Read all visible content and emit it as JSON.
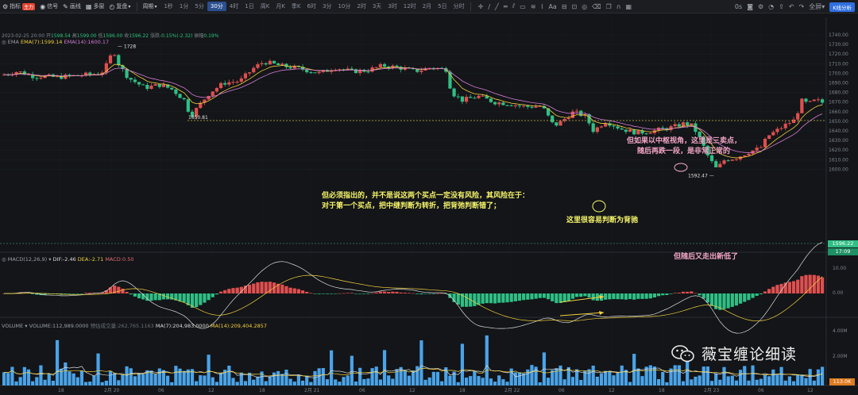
{
  "toolbar": {
    "indicators_label": "指标",
    "indicators_badge": "主力",
    "signal_label": "信号",
    "draw_label": "画线",
    "multi_label": "多窗",
    "replay_label": "复盘",
    "period_label": "周期",
    "intervals": [
      "1秒",
      "1分",
      "5分",
      "30分",
      "4时",
      "1日",
      "周K",
      "月K",
      "季K",
      "6时",
      "3分",
      "10分",
      "2时",
      "3天",
      "3时",
      "12时",
      "2月",
      "5日",
      "分时"
    ],
    "active_interval": "30分",
    "text_tool": "Aa",
    "time_readout": "0s",
    "fullscreen_label": "全屏",
    "kline_button": "K线分析"
  },
  "header": {
    "ohlc_date": "2023-02-25 20:00",
    "ohlc_open_label": "开",
    "ohlc_open": "1598.54",
    "ohlc_high_label": "高",
    "ohlc_high": "1599.00",
    "ohlc_low_label": "低",
    "ohlc_low": "1596.00",
    "ohlc_close_label": "收",
    "ohlc_close": "1596.22",
    "ohlc_change_label": "涨跌",
    "ohlc_change": "-0.15%(-2.32)",
    "ohlc_amp_label": "振幅",
    "ohlc_amp": "0.19%",
    "ema_name": "EMA",
    "ema7": "EMA(7):1599.14",
    "ema14": "EMA(14):1600.17"
  },
  "macd": {
    "name": "MACD(12,26,9)",
    "dif": "DIF:-2.46",
    "dea": "DEA:-2.71",
    "macd": "MACD:0.50",
    "axis": [
      "10.00",
      "0.00"
    ]
  },
  "volume": {
    "name": "VOLUME",
    "vol": "VOLUME:112,989.0000",
    "vol_amt": "预估成交量:262,765.1163",
    "ma7": "MA(7):204,983.0000",
    "ma14": "MA(14):209,404.2857",
    "axis": [
      "4.00M",
      "2.00M"
    ],
    "last_tag": "113.0K"
  },
  "price_axis": [
    "1740.00",
    "1730.00",
    "1720.00",
    "1710.00",
    "1700.00",
    "1690.00",
    "1680.00",
    "1670.00",
    "1660.00",
    "1650.00",
    "1640.00",
    "1630.00",
    "1620.00",
    "1610.00",
    "1600.00"
  ],
  "last_price_tag": "1596.22",
  "countdown_tag": "17:09",
  "price_marks": {
    "high": "1728",
    "mid_low": "1650.81",
    "low": "1592.47"
  },
  "time_axis": [
    "18",
    "2月 20",
    "06",
    "12",
    "18",
    "2月 21",
    "06",
    "12",
    "18",
    "2月 22",
    "06",
    "12",
    "18",
    "2月 23",
    "06",
    "12"
  ],
  "annotations": {
    "third_sell_1": "但如果以中枢视角，这里是三卖点，",
    "third_sell_2": "随后再跌一段，是非常正常的",
    "risk_1": "但必须指出的，并不是说这两个买点一定没有风险，其风险在于：",
    "risk_2": "对于第一个买点，把中继判断为转折，把背弛判断错了；",
    "divergence": "这里很容易判断为背驰",
    "new_low": "但随后又走出新低了"
  },
  "watermark": "薇宝缠论细读",
  "colors": {
    "up": "#e04f4f",
    "down": "#2fbf85",
    "accent": "#2f6fe0",
    "ema7": "#f4d03f",
    "ema14": "#d67bd6"
  }
}
